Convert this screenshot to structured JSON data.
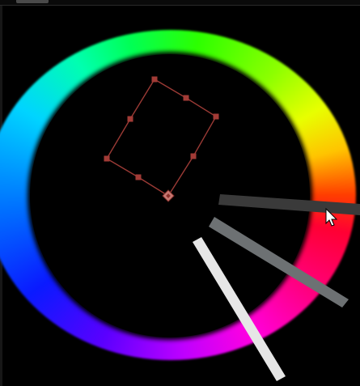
{
  "window": {
    "title": ""
  },
  "colors": {
    "background": "#000000",
    "harmony_outline": "#9a3a35",
    "harmony_point": "#a23b36",
    "harmony_base_point": "#c87872",
    "wheel_hue_start": "#ff0000"
  },
  "color_wheel": {
    "ring_type": "hue-ring",
    "harmony_shape": "rectangle",
    "harmony_points_count": 8
  },
  "sliders": [
    {
      "name": "dark-gray-slider",
      "color": "#3a3a3a"
    },
    {
      "name": "mid-gray-slider",
      "color": "#6d7173"
    },
    {
      "name": "light-gray-slider",
      "color": "#e6e6e6"
    }
  ],
  "cursor": {
    "icon": "mouse-pointer-icon"
  }
}
